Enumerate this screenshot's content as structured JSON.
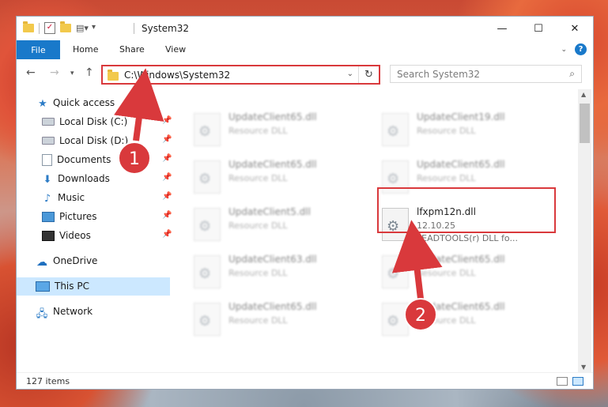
{
  "window": {
    "title": "System32",
    "minimize_icon": "minimize-icon",
    "maximize_icon": "maximize-icon",
    "close_icon": "close-icon"
  },
  "ribbon": {
    "tabs": [
      "File",
      "Home",
      "Share",
      "View"
    ],
    "help_label": "?"
  },
  "navigation": {
    "address": "C:\\Windows\\System32",
    "search_placeholder": "Search System32"
  },
  "sidebar": {
    "quick_access": "Quick access",
    "items": [
      {
        "label": "Local Disk (C:)",
        "icon": "drive-icon"
      },
      {
        "label": "Local Disk (D:)",
        "icon": "drive-icon"
      },
      {
        "label": "Documents",
        "icon": "documents-icon"
      },
      {
        "label": "Downloads",
        "icon": "downloads-icon"
      },
      {
        "label": "Music",
        "icon": "music-icon"
      },
      {
        "label": "Pictures",
        "icon": "pictures-icon"
      },
      {
        "label": "Videos",
        "icon": "videos-icon"
      }
    ],
    "onedrive": "OneDrive",
    "this_pc": "This PC",
    "network": "Network"
  },
  "files": [
    {
      "name": "UpdateClient65.dll",
      "type": "Resource DLL"
    },
    {
      "name": "UpdateClient19.dll",
      "type": "Resource DLL"
    },
    {
      "name": "UpdateClient65.dll",
      "type": "Resource DLL"
    },
    {
      "name": "UpdateClient65.dll",
      "type": "Resource DLL"
    },
    {
      "name": "UpdateClient5.dll",
      "type": "Resource DLL"
    },
    {
      "name": "UpdateClient63.dll",
      "type": "Resource DLL"
    },
    {
      "name": "UpdateClient65.dll",
      "type": "Resource DLL"
    },
    {
      "name": "UpdateClient65.dll",
      "type": "Resource DLL"
    },
    {
      "name": "UpdateClient65.dll",
      "type": "Resource DLL"
    }
  ],
  "highlighted_file": {
    "name": "lfxpm12n.dll",
    "version": "12.10.25",
    "description": "LEADTOOLS(r) DLL fo..."
  },
  "annotations": {
    "step1": "1",
    "step2": "2",
    "color": "#d9393c"
  },
  "status": {
    "item_count": "127 items"
  }
}
